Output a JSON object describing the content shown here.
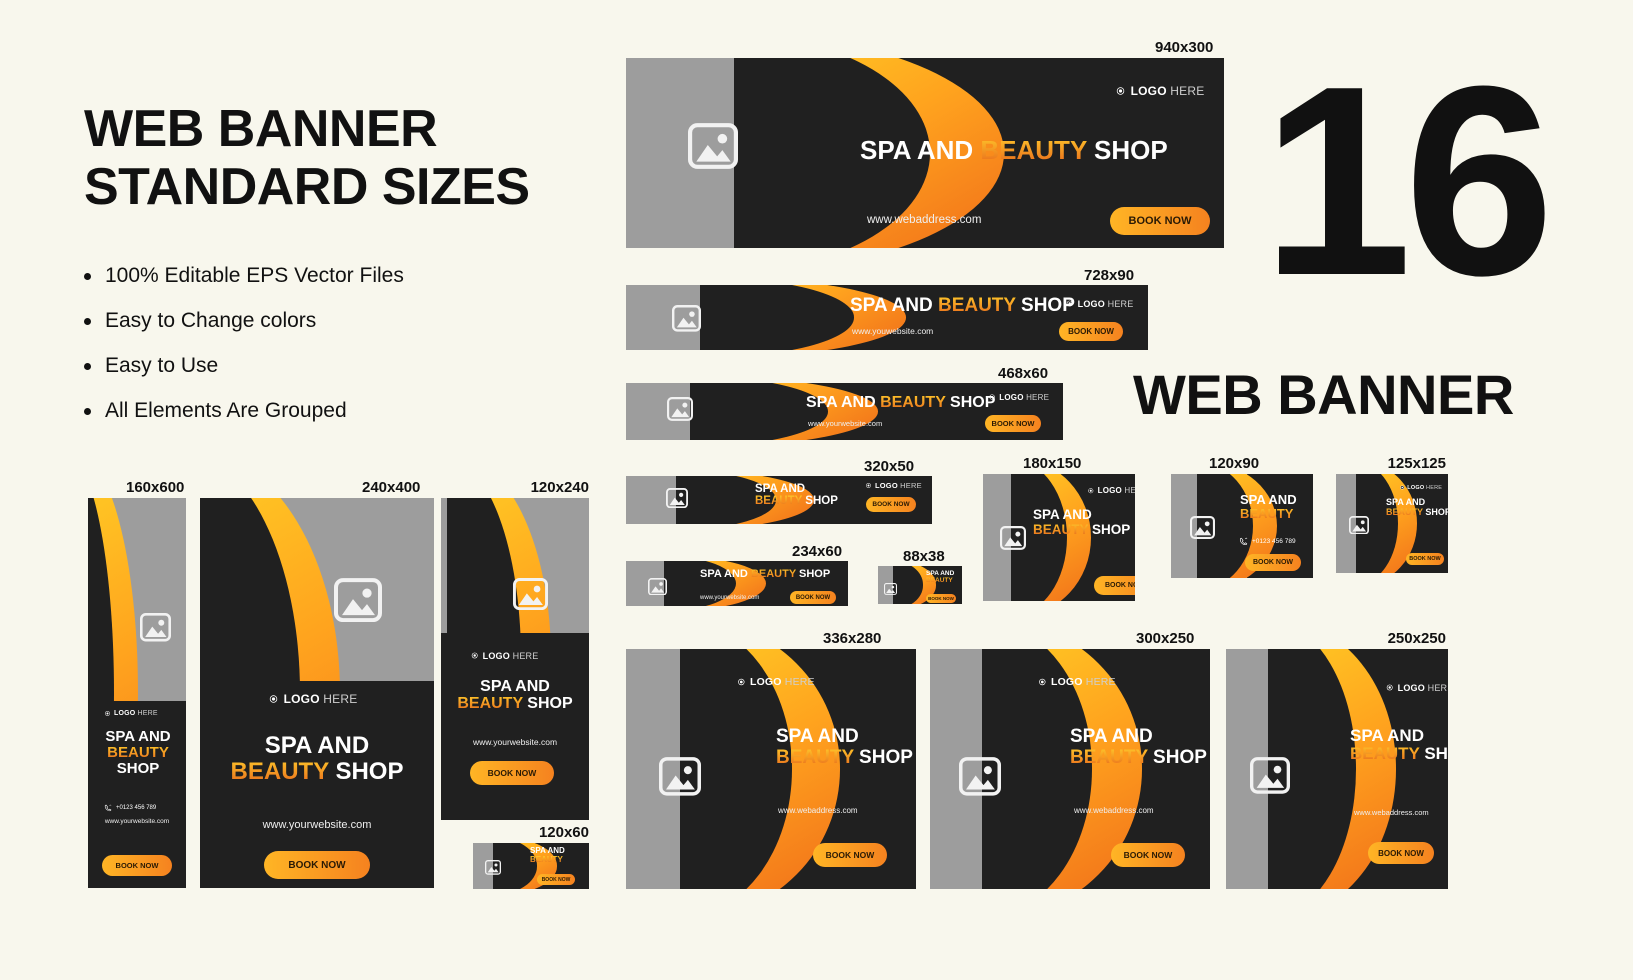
{
  "page": {
    "background": "#f8f7ed",
    "heading": "WEB BANNER\nSTANDARD SIZES",
    "features": [
      "100% Editable EPS Vector Files",
      "Easy to Change colors",
      "Easy to Use",
      "All Elements Are Grouped"
    ],
    "big_number": "16",
    "big_word": "WEB BANNER"
  },
  "brand": {
    "logo_bold": "LOGO",
    "logo_light": " HERE",
    "title_a": "SPA AND ",
    "title_b": "BEAUTY",
    "title_c": " SHOP",
    "title_line1": "SPA AND",
    "title_line2_b": "BEAUTY",
    "title_line2_c": " SHOP",
    "button": "BOOK NOW",
    "phone": "+0123 456 789",
    "url_your": "www.yourwebsite.com",
    "url_you": "www.youwebsite.com",
    "url_web": "www.webaddress.com",
    "colors": {
      "dark": "#202020",
      "gray": "#9d9d9d",
      "orange_light": "#ffc724",
      "orange_dark": "#f2741a",
      "accent_text": "#ed8020"
    }
  },
  "banners": [
    {
      "id": "940x300",
      "label": "940x300"
    },
    {
      "id": "728x90",
      "label": "728x90"
    },
    {
      "id": "468x60",
      "label": "468x60"
    },
    {
      "id": "320x50",
      "label": "320x50"
    },
    {
      "id": "234x60",
      "label": "234x60"
    },
    {
      "id": "88x38",
      "label": "88x38"
    },
    {
      "id": "180x150",
      "label": "180x150"
    },
    {
      "id": "120x90",
      "label": "120x90"
    },
    {
      "id": "125x125",
      "label": "125x125"
    },
    {
      "id": "336x280",
      "label": "336x280"
    },
    {
      "id": "300x250",
      "label": "300x250"
    },
    {
      "id": "250x250",
      "label": "250x250"
    },
    {
      "id": "160x600",
      "label": "160x600"
    },
    {
      "id": "240x400",
      "label": "240x400"
    },
    {
      "id": "120x240",
      "label": "120x240"
    },
    {
      "id": "120x60",
      "label": "120x60"
    }
  ]
}
